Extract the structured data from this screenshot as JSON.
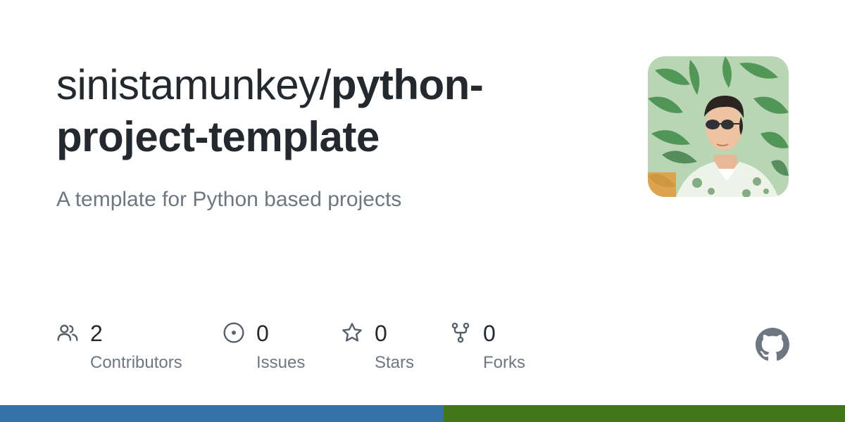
{
  "repo": {
    "owner": "sinistamunkey/",
    "name": "python-project-template",
    "description": "A template for Python based projects"
  },
  "avatar": {
    "icon": "user-avatar-photo",
    "background": "#8fbf8a"
  },
  "stats": [
    {
      "icon": "people-icon",
      "count": "2",
      "label": "Contributors"
    },
    {
      "icon": "issue-opened-icon",
      "count": "0",
      "label": "Issues"
    },
    {
      "icon": "star-icon",
      "count": "0",
      "label": "Stars"
    },
    {
      "icon": "repo-forked-icon",
      "count": "0",
      "label": "Forks"
    }
  ],
  "colors": {
    "title": "#24292f",
    "muted": "#6e7781",
    "icon": "#57606a",
    "github_mark": "#6e7781"
  },
  "languages": [
    {
      "color": "#3572a5",
      "share": 52.5
    },
    {
      "color": "#427819",
      "share": 47.5
    }
  ]
}
